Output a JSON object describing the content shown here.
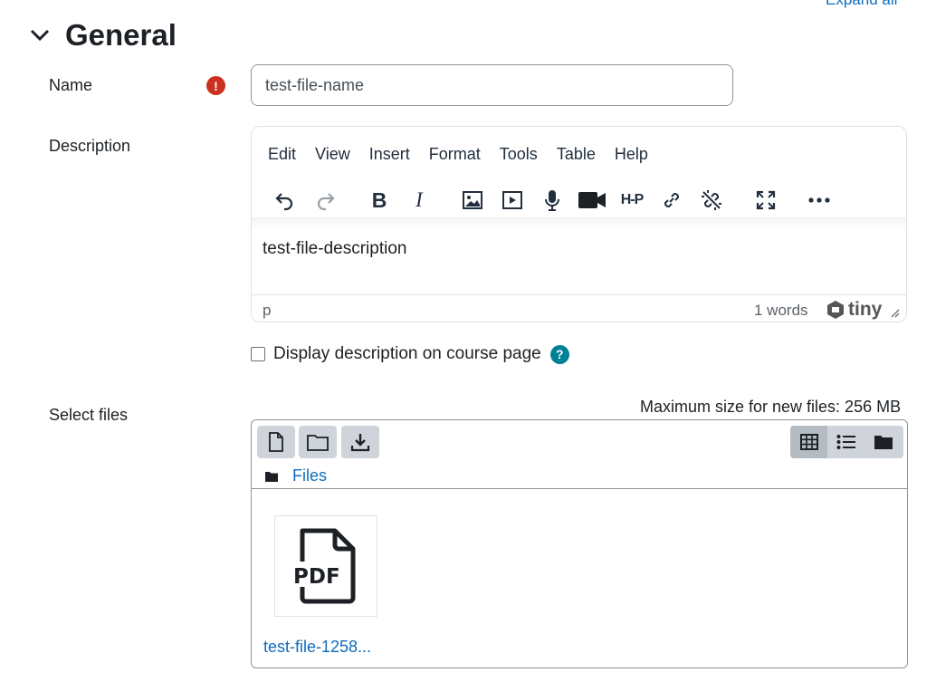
{
  "header": {
    "expand_all": "Expand all",
    "section_title": "General"
  },
  "fields": {
    "name": {
      "label": "Name",
      "value": "test-file-name",
      "required_icon": "exclamation-icon"
    },
    "description": {
      "label": "Description"
    },
    "select_files": {
      "label": "Select files"
    }
  },
  "editor": {
    "menu": [
      "Edit",
      "View",
      "Insert",
      "Format",
      "Tools",
      "Table",
      "Help"
    ],
    "toolbar_icons": [
      "undo-icon",
      "redo-icon",
      "bold-icon",
      "italic-icon",
      "image-icon",
      "media-icon",
      "microphone-icon",
      "video-camera-icon",
      "h5p-icon",
      "link-icon",
      "unlink-icon",
      "fullscreen-icon",
      "more-icon"
    ],
    "bold_glyph": "B",
    "italic_glyph": "I",
    "h5p_glyph": "H-P",
    "content": "test-file-description",
    "status_path": "p",
    "word_count": "1 words",
    "brand": "tiny"
  },
  "display_description": {
    "label": "Display description on course page",
    "checked": false,
    "help_glyph": "?"
  },
  "filepicker": {
    "max_size": "Maximum size for new files: 256 MB",
    "buttons": [
      "add-file-icon",
      "create-folder-icon",
      "download-icon"
    ],
    "views": [
      "grid-view-icon",
      "list-view-icon",
      "tree-view-icon"
    ],
    "breadcrumb": "Files",
    "files": [
      {
        "name": "test-file-1258...",
        "type_label": "PDF"
      }
    ]
  },
  "colors": {
    "link": "#0f6cbf",
    "required": "#ca3120",
    "help": "#008196",
    "button_bg": "#ced4da"
  }
}
